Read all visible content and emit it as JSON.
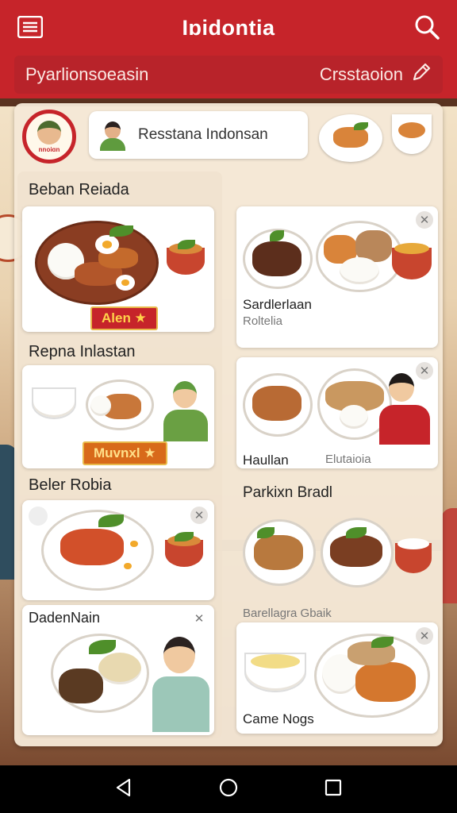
{
  "appbar": {
    "title": "Iɒidontia",
    "subtitle_left": "Pyarlionsoeasin",
    "subtitle_right": "Crsstaoion"
  },
  "header": {
    "logo_text": "nnoiɑn",
    "restaurant_name": "Resstana Indonsan"
  },
  "left_column": {
    "section1_title": "Beban Reiada",
    "card1_tag": "Alen ★",
    "section2_title": "Repna Inlastan",
    "card2_tag": "Muvnxl ★",
    "section3_title": "Beler Robia",
    "card4_title": "DadenNain"
  },
  "right_column": {
    "card1_label": "Sardlerlaan",
    "card1_sub": "Roltelia",
    "card2_label": "Haullan",
    "card2_sub": "Elutaioia",
    "section_title": "Parkixn Bradl",
    "card3_sub": "Barellagra Gbaik",
    "card4_label": "Came Nogs"
  },
  "colors": {
    "brand_red": "#c6242a",
    "panel_bg": "#f5e8d6"
  },
  "icons": {
    "menu": "menu-icon",
    "search": "search-icon",
    "edit": "pencil-icon",
    "close": "close-icon",
    "back": "nav-back-icon",
    "home": "nav-home-icon",
    "recents": "nav-recents-icon"
  }
}
